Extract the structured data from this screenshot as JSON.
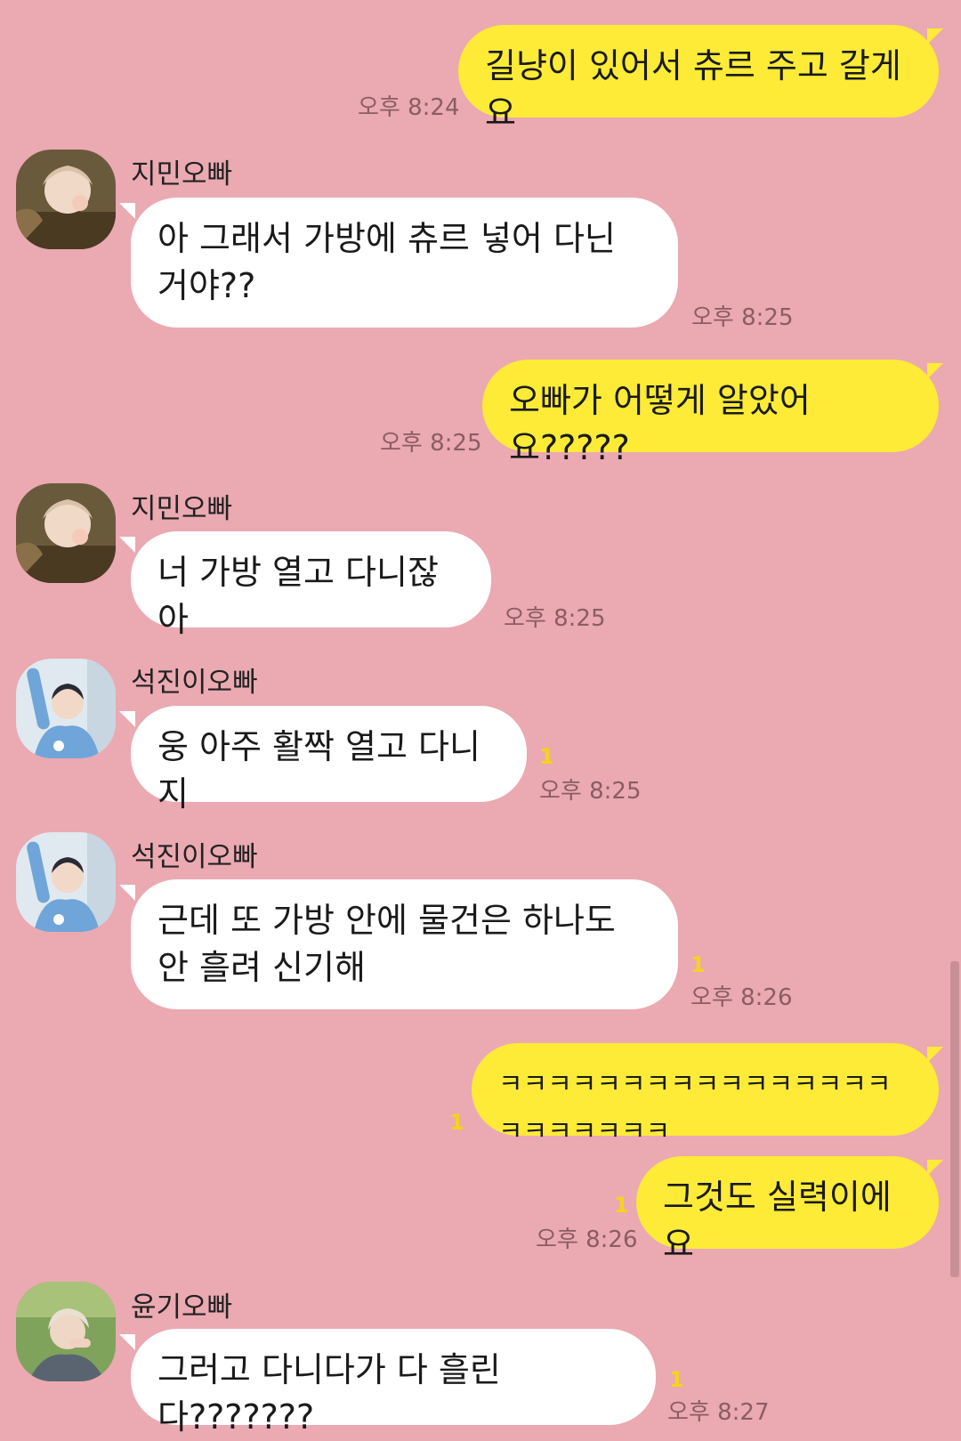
{
  "messages": [
    {
      "type": "out",
      "text": "길냥이 있어서 츄르 주고 갈게요",
      "time": "오후 8:24",
      "unread": ""
    },
    {
      "type": "in",
      "sender": "지민오빠",
      "text": "아 그래서 가방에 츄르 넣어 다닌 거야??",
      "time": "오후 8:25",
      "unread": ""
    },
    {
      "type": "out",
      "text": "오빠가 어떻게 알았어요?????",
      "time": "오후 8:25",
      "unread": ""
    },
    {
      "type": "in",
      "sender": "지민오빠",
      "text": "너 가방 열고 다니잖아",
      "time": "오후 8:25",
      "unread": ""
    },
    {
      "type": "in",
      "sender": "석진이오빠",
      "text": "웅 아주 활짝 열고 다니지",
      "time": "오후 8:25",
      "unread": "1"
    },
    {
      "type": "in",
      "sender": "석진이오빠",
      "text": "근데 또 가방 안에 물건은 하나도 안 흘려 신기해",
      "time": "오후 8:26",
      "unread": "1"
    },
    {
      "type": "out",
      "text": "ㅋㅋㅋㅋㅋㅋㅋㅋㅋㅋㅋㅋㅋㅋㅋㅋㅋㅋㅋㅋㅋㅋㅋ",
      "time": "",
      "unread": "1"
    },
    {
      "type": "out",
      "text": "그것도 실력이에요",
      "time": "오후 8:26",
      "unread": "1"
    },
    {
      "type": "in",
      "sender": "윤기오빠",
      "text": "그러고 다니다가 다 흘린다???????",
      "time": "오후 8:27",
      "unread": "1"
    }
  ],
  "colors": {
    "background": "#eba9b2",
    "incoming_bubble": "#ffffff",
    "outgoing_bubble": "#fdeb37",
    "unread": "#f7d21c"
  },
  "icons": [
    "avatar-jimin",
    "avatar-seokjin",
    "avatar-yoongi"
  ]
}
